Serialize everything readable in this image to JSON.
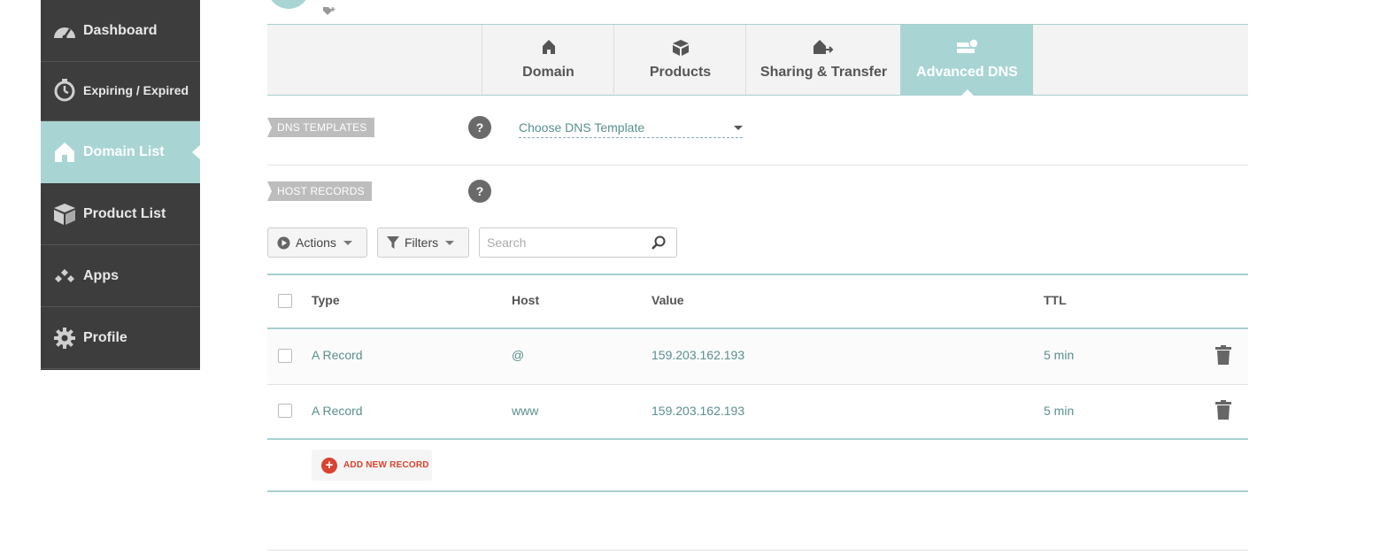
{
  "sidebar": {
    "items": [
      {
        "label": "Dashboard",
        "icon": "speedometer-icon"
      },
      {
        "label": "Expiring / Expired",
        "icon": "stopwatch-icon"
      },
      {
        "label": "Domain List",
        "icon": "home-icon",
        "active": true
      },
      {
        "label": "Product List",
        "icon": "box-icon"
      },
      {
        "label": "Apps",
        "icon": "apps-diamonds-icon"
      },
      {
        "label": "Profile",
        "icon": "gear-icon"
      }
    ]
  },
  "tabs": [
    {
      "label": "Domain",
      "icon": "home-icon"
    },
    {
      "label": "Products",
      "icon": "box-icon"
    },
    {
      "label": "Sharing & Transfer",
      "icon": "share-transfer-icon"
    },
    {
      "label": "Advanced DNS",
      "icon": "dns-server-icon",
      "active": true
    }
  ],
  "dns_templates": {
    "label": "DNS TEMPLATES",
    "help": "?",
    "select_value": "Choose DNS Template"
  },
  "host_records": {
    "label": "HOST RECORDS",
    "help": "?"
  },
  "toolbar": {
    "actions_label": "Actions",
    "filters_label": "Filters",
    "search_placeholder": "Search"
  },
  "table": {
    "columns": [
      "Type",
      "Host",
      "Value",
      "TTL"
    ],
    "rows": [
      {
        "type": "A Record",
        "host": "@",
        "value": "159.203.162.193",
        "ttl": "5 min"
      },
      {
        "type": "A Record",
        "host": "www",
        "value": "159.203.162.193",
        "ttl": "5 min"
      }
    ],
    "add_label": "ADD NEW RECORD"
  },
  "colors": {
    "sidebar_bg": "#3d3d3d",
    "accent": "#a8d5d4",
    "link_text": "#5a8f8f",
    "danger": "#d9432f"
  }
}
